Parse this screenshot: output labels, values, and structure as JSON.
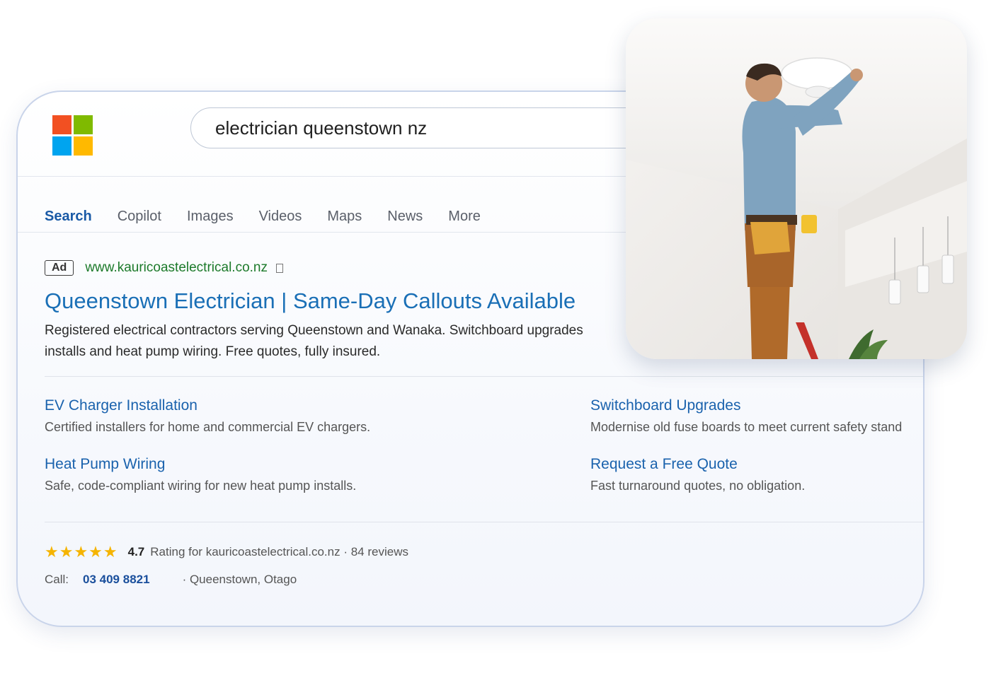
{
  "brand": {
    "logo_icon": "microsoft-logo-icon",
    "colors": [
      "#f25022",
      "#7fba00",
      "#00a4ef",
      "#ffb900"
    ]
  },
  "search": {
    "query": "electrician queenstown nz"
  },
  "tabs": [
    {
      "label": "Search",
      "active": true
    },
    {
      "label": "Copilot"
    },
    {
      "label": "Images"
    },
    {
      "label": "Videos"
    },
    {
      "label": "Maps"
    },
    {
      "label": "News"
    },
    {
      "label": "More"
    }
  ],
  "ad": {
    "badge": "Ad",
    "url": "www.kauricoastelectrical.co.nz",
    "headline": "Queenstown Electrician | Same-Day Callouts Available",
    "description_line1": "Registered electrical contractors serving Queenstown and Wanaka. Switchboard upgrades",
    "description_line2": "installs and heat pump wiring. Free quotes, fully insured.",
    "sitelinks": [
      {
        "title": "EV Charger Installation",
        "desc": "Certified installers for home and commercial EV chargers."
      },
      {
        "title": "Switchboard Upgrades",
        "desc": "Modernise old fuse boards to meet current safety stand"
      },
      {
        "title": "Heat Pump Wiring",
        "desc": "Safe, code-compliant wiring for new heat pump installs."
      },
      {
        "title": "Request a Free Quote",
        "desc": "Fast turnaround quotes, no obligation."
      }
    ],
    "rating": {
      "stars": "★★★★★",
      "value": "4.7",
      "text": "Rating for kauricoastelectrical.co.nz · 84 reviews"
    },
    "call_label": "Call:",
    "phone": "03 409 8821",
    "location": "· Queenstown, Otago"
  },
  "photo": {
    "subject": "electrician-installing-ceiling-light-image"
  }
}
